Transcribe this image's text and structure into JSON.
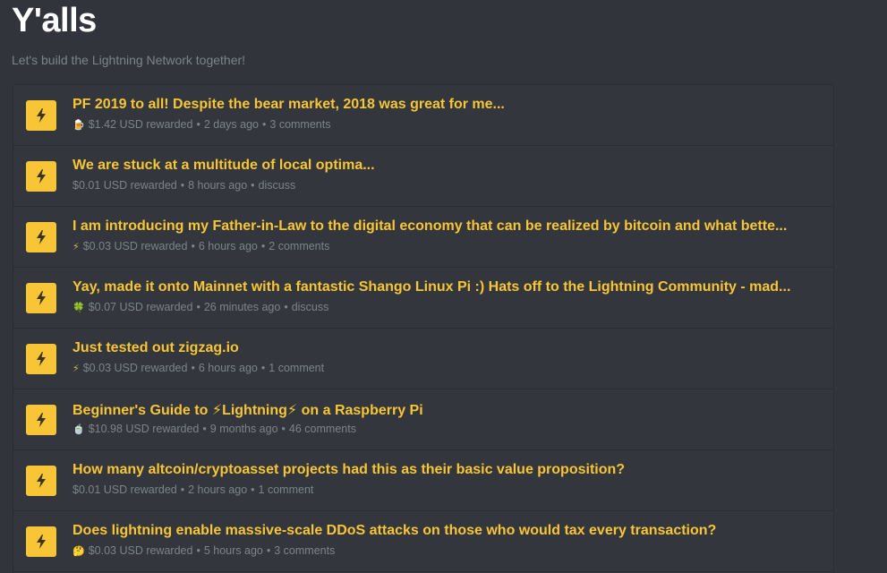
{
  "header": {
    "title": "Y'alls",
    "subtitle": "Let's build the Lightning Network together!"
  },
  "colors": {
    "background": "#31353b",
    "accent": "#f7c535",
    "muted_text": "#7d838b"
  },
  "posts": [
    {
      "title": "PF 2019 to all! Despite the bear market, 2018 was great for me...",
      "meta_icon": "🍺",
      "meta_icon_name": "beer-icon",
      "reward": "$1.42 USD rewarded",
      "age": "2 days ago",
      "comments": "3 comments"
    },
    {
      "title": "We are stuck at a multitude of local optima...",
      "meta_icon": "",
      "meta_icon_name": "",
      "reward": "$0.01 USD rewarded",
      "age": "8 hours ago",
      "comments": "discuss"
    },
    {
      "title": "I am introducing my Father-in-Law to the digital economy that can be realized by bitcoin and what bette...",
      "meta_icon": "⚡",
      "meta_icon_name": "lightning-icon",
      "reward": "$0.03 USD rewarded",
      "age": "6 hours ago",
      "comments": "2 comments"
    },
    {
      "title": "Yay, made it onto Mainnet with a fantastic Shango Linux Pi :) Hats off to the Lightning Community - mad...",
      "meta_icon": "🍀",
      "meta_icon_name": "clover-icon",
      "reward": "$0.07 USD rewarded",
      "age": "26 minutes ago",
      "comments": "discuss"
    },
    {
      "title": "Just tested out zigzag.io",
      "meta_icon": "⚡",
      "meta_icon_name": "lightning-icon",
      "reward": "$0.03 USD rewarded",
      "age": "6 hours ago",
      "comments": "1 comment"
    },
    {
      "title_parts": [
        "Beginner's Guide to ",
        "⚡",
        "Lightning",
        "⚡",
        " on a Raspberry Pi"
      ],
      "meta_icon": "🍵",
      "meta_icon_name": "tea-icon",
      "reward": "$10.98 USD rewarded",
      "age": "9 months ago",
      "comments": "46 comments"
    },
    {
      "title": "How many altcoin/cryptoasset projects had this as their basic value proposition?",
      "meta_icon": "",
      "meta_icon_name": "",
      "reward": "$0.01 USD rewarded",
      "age": "2 hours ago",
      "comments": "1 comment"
    },
    {
      "title": "Does lightning enable massive-scale DDoS attacks on those who would tax every transaction?",
      "meta_icon": "🤔",
      "meta_icon_name": "thinking-face-icon",
      "reward": "$0.03 USD rewarded",
      "age": "5 hours ago",
      "comments": "3 comments"
    }
  ]
}
